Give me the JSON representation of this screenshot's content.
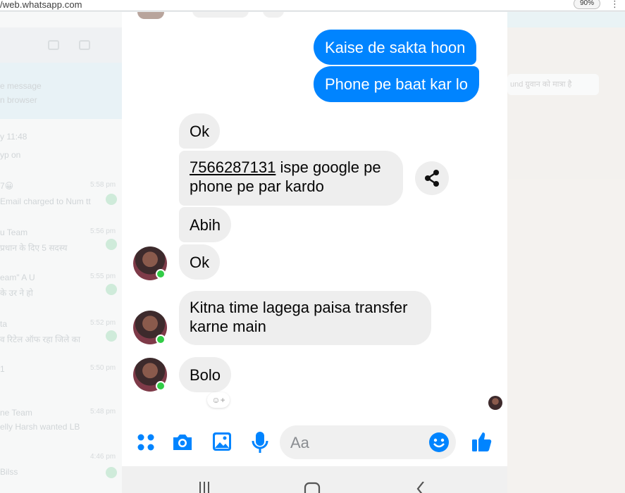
{
  "browser": {
    "url": "web.whatsapp.com",
    "url_prefix": "/",
    "zoom": "90%",
    "menu_icon": "more-vert-icon"
  },
  "background_left": {
    "lines": [
      "e message",
      "n browser",
      "y 11:48",
      "yp on",
      "7😀",
      "Email charged to Num tt",
      "u Team",
      "प्रधान के दिए 5 सदस्य",
      "eam\" A U",
      "के उर ने हो",
      "ta",
      "व रिटेल ऑफ रहा जिले का",
      "1",
      "ne Team",
      "elly Harsh wanted LB",
      "Bilss"
    ],
    "times": [
      "5:58 pm",
      "5:56 pm",
      "5:55 pm",
      "5:52 pm",
      "5:50 pm",
      "5:48 pm",
      "4:46 pm"
    ]
  },
  "background_right": {
    "pill": "und ग्रुवान को मात्रा है"
  },
  "messages": {
    "out_1": "Kaise de sakta hoon",
    "out_2": "Phone pe baat kar lo",
    "in_1": "Ok",
    "in_2_number": "7566287131",
    "in_2_rest": " ispe google pe",
    "in_2_line2": "phone pe par kardo",
    "in_3": "Abih",
    "in_4": "Ok",
    "in_5_line1": "Kitna time lagega paisa transfer",
    "in_5_line2": "karne main",
    "in_6": "Bolo"
  },
  "composer": {
    "placeholder": "Aa",
    "icons": [
      "apps-icon",
      "camera-icon",
      "gallery-icon",
      "microphone-icon",
      "emoji-icon",
      "thumbs-up-icon"
    ],
    "accent": "#0084ff"
  },
  "reaction_plus": "+",
  "colors": {
    "outgoing": "#0084ff",
    "incoming": "#eeeeee",
    "online": "#31cc46"
  }
}
